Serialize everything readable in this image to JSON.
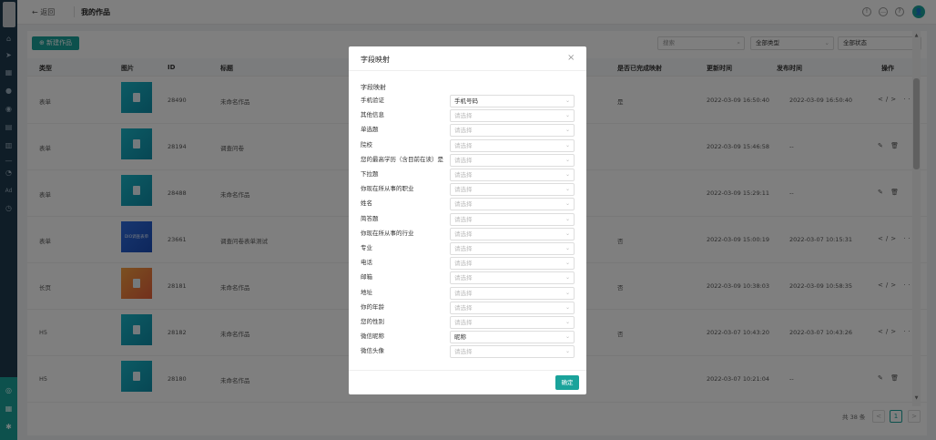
{
  "sidebar": {
    "ad_label": "Ad"
  },
  "topbar": {
    "back_label": "← 返回",
    "title": "我的作品",
    "avatar": "👤"
  },
  "toolbar": {
    "new_label": "新建作品",
    "search_placeholder": "搜索",
    "type_filter": "全部类型",
    "status_filter": "全部状态"
  },
  "table": {
    "headers": {
      "type": "类型",
      "image": "图片",
      "id": "ID",
      "title": "标题",
      "mapped": "是否已完成映射",
      "updated": "更新时间",
      "published": "发布时间",
      "ops": "操作"
    },
    "rows": [
      {
        "type": "表单",
        "id": "28490",
        "title": "未命名作品",
        "mapped": "是",
        "updated": "2022-03-09 16:50:40",
        "published": "2022-03-09 16:50:40",
        "thumb": "",
        "ops": "</> ···"
      },
      {
        "type": "表单",
        "id": "28194",
        "title": "调查问卷",
        "mapped": "",
        "updated": "2022-03-09 15:46:58",
        "published": "--",
        "thumb": "",
        "ops": "✎ 🗑"
      },
      {
        "type": "表单",
        "id": "28488",
        "title": "未命名作品",
        "mapped": "",
        "updated": "2022-03-09 15:29:11",
        "published": "--",
        "thumb": "",
        "ops": "✎ 🗑"
      },
      {
        "type": "表单",
        "id": "23661",
        "title": "调查问卷表单测试",
        "mapped": "否",
        "updated": "2022-03-09 15:00:19",
        "published": "2022-03-07 10:15:31",
        "thumb": "DIO调查表单",
        "ops": "</> ···"
      },
      {
        "type": "长页",
        "id": "28181",
        "title": "未命名作品",
        "mapped": "否",
        "updated": "2022-03-09 10:38:03",
        "published": "2022-03-09 10:58:35",
        "thumb": "",
        "ops": "</> ···"
      },
      {
        "type": "H5",
        "id": "28182",
        "title": "未命名作品",
        "mapped": "否",
        "updated": "2022-03-07 10:43:20",
        "published": "2022-03-07 10:43:26",
        "thumb": "",
        "ops": "</> ···"
      },
      {
        "type": "H5",
        "id": "28180",
        "title": "未命名作品",
        "mapped": "",
        "updated": "2022-03-07 10:21:04",
        "published": "--",
        "thumb": "",
        "ops": "✎ 🗑"
      }
    ]
  },
  "pagination": {
    "total": "共 38 条",
    "prev": "<",
    "current": "1",
    "next": ">"
  },
  "modal": {
    "title": "字段映射",
    "close": "×",
    "section": "字段映射",
    "fields": [
      {
        "label": "手机验证",
        "value": "手机号码",
        "filled": true
      },
      {
        "label": "其他信息",
        "value": "请选择",
        "filled": false
      },
      {
        "label": "单选题",
        "value": "请选择",
        "filled": false
      },
      {
        "label": "院校",
        "value": "请选择",
        "filled": false
      },
      {
        "label": "您的最高学历（含目前在读）是",
        "value": "请选择",
        "filled": false
      },
      {
        "label": "下拉题",
        "value": "请选择",
        "filled": false
      },
      {
        "label": "你现在所从事的职业",
        "value": "请选择",
        "filled": false
      },
      {
        "label": "姓名",
        "value": "请选择",
        "filled": false
      },
      {
        "label": "简答题",
        "value": "请选择",
        "filled": false
      },
      {
        "label": "你现在所从事的行业",
        "value": "请选择",
        "filled": false
      },
      {
        "label": "专业",
        "value": "请选择",
        "filled": false
      },
      {
        "label": "电话",
        "value": "请选择",
        "filled": false
      },
      {
        "label": "邮箱",
        "value": "请选择",
        "filled": false
      },
      {
        "label": "地址",
        "value": "请选择",
        "filled": false
      },
      {
        "label": "你的年龄",
        "value": "请选择",
        "filled": false
      },
      {
        "label": "您的性别",
        "value": "请选择",
        "filled": false
      },
      {
        "label": "微信昵称",
        "value": "昵称",
        "filled": true
      },
      {
        "label": "微信头像",
        "value": "请选择",
        "filled": false
      }
    ],
    "confirm_label": "确定"
  }
}
